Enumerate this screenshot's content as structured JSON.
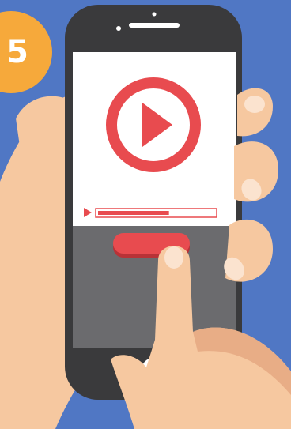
{
  "step": {
    "number": "5"
  },
  "video": {
    "progress": 0.61
  },
  "colors": {
    "background": "#5077c4",
    "badge": "#f6a93b",
    "accent": "#e84b4f",
    "phone": "#3a3a3c",
    "screen_lower": "#6b6b6e",
    "skin": "#f6c8a0",
    "skin_shadow": "#e8ad86"
  },
  "icons": {
    "play_button": "play-circle-icon",
    "progress_play": "play-small-icon"
  }
}
